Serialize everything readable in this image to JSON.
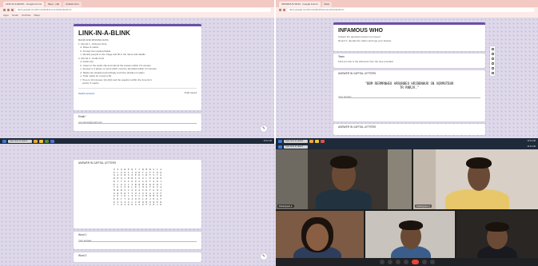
{
  "tl": {
    "tabs": [
      "LINK-IN-A-BLINK - Google Forms",
      "Meet - call",
      "Untitled form"
    ],
    "address": "docs.google.com/forms/d/e/link-in-a-blink/viewform",
    "bookmarks": [
      "Apps",
      "Gmail",
      "YouTube",
      "Maps"
    ],
    "form_title": "LINK-IN-A-BLINK",
    "description": [
      "BLIND AND MISSING DATA",
      "1. Round 1 - Pictures hints",
      "   a. Rules & marks",
      "   b. Answer the required fields",
      "   c. Identify people in the image and fill in the name and details",
      "2. Round 2 - Audio hints",
      "   a. Audio clip",
      "   b. Listen to the audio clip and submit the answer within 15 minutes",
      "   c. Answer is 3 letters or word which must be identified within 10 minutes",
      "   d. Marks are awarded accordingly and time duration is taken",
      "   e. Total marks for round is 60",
      "   f. Time is 10 minutes; Q1-Q10 and the question within the time limit",
      "      points: 5 marks"
    ],
    "link_text": "Switch account",
    "draft_note": "Draft saved",
    "field_label": "Email",
    "required_marker": "*",
    "field_value": "yourname@gmail.com"
  },
  "tr": {
    "tabs": [
      "INFAMOUS WHO - Google Forms",
      "Meet"
    ],
    "address": "docs.google.com/forms/d/e/infamous-who/viewform",
    "form_title": "INFAMOUS WHO",
    "description_lines": [
      "Answer the questions below to proceed",
      "Round 1: decode the cipher and type your answer"
    ],
    "question1_label": "Team",
    "question1_text": "Find out who is the infamous from the clue provided",
    "section_label": "ANSWER IN CAPITAL LETTERS",
    "cipher_text": "\"BBM RERMRNHEO ARRUNBEO HRIBBNHUR SN XQRMUTBUR\nTR RNRJV.\"",
    "answer_placeholder": "Your answer",
    "footer_label": "ANSWER IN CAPITAL LETTERS"
  },
  "bl": {
    "section_label": "ANSWER IN CAPITAL LETTERS",
    "grid_rows": [
      "ZXQWERTYNMBVCA",
      "PLOKIJUHYGTFRD",
      "QAZWSXEDCRFVTG",
      "BHUJMNIKOLPQWE",
      "RTYUIOPASDFGHJ",
      "KLZXCVBNMQWERT",
      "YUIOPLKJHGFDSA",
      "MNBVCXZASDFGHJ",
      "QWERTYUIOPASDF",
      "GHJKLZXCVBNMQW",
      "ERTYUIOPLKJHGF",
      "DSAZXCVBNMQWER",
      "TYUIOPASDFGHJK"
    ],
    "field1_label": "Word 1",
    "field1_value": "Your answer",
    "field2_label": "Word 2"
  },
  "taskbar": {
    "search_placeholder": "Type here to search",
    "clock": "10:42 AM"
  },
  "meet": {
    "participants": [
      "Participant 1",
      "Participant 2",
      "Participant 3",
      "Participant 4",
      "Participant 5"
    ]
  }
}
